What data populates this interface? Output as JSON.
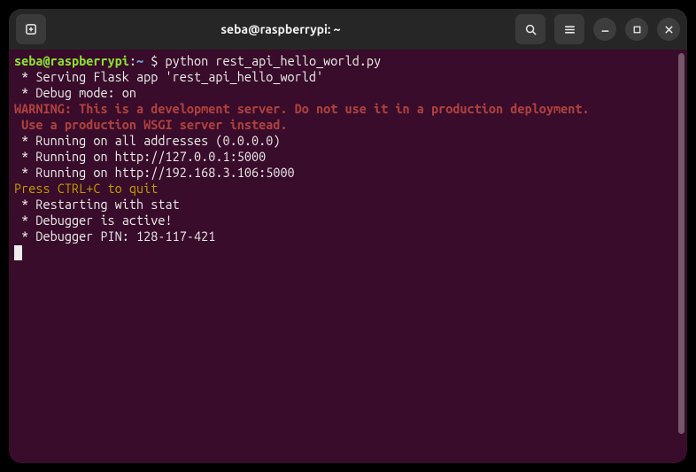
{
  "window": {
    "title": "seba@raspberrypi: ~"
  },
  "prompt": {
    "user_host": "seba@raspberrypi",
    "sep1": ":",
    "path": "~",
    "sep2": " $ ",
    "command": "python rest_api_hello_world.py"
  },
  "lines": {
    "l1": " * Serving Flask app 'rest_api_hello_world'",
    "l2": " * Debug mode: on",
    "l3": "WARNING: This is a development server. Do not use it in a production deployment.",
    "l4": " Use a production WSGI server instead.",
    "l5": " * Running on all addresses (0.0.0.0)",
    "l6": " * Running on http://127.0.0.1:5000",
    "l7": " * Running on http://192.168.3.106:5000",
    "l8": "Press CTRL+C to quit",
    "l9": " * Restarting with stat",
    "l10": " * Debugger is active!",
    "l11": " * Debugger PIN: 128-117-421"
  },
  "icons": {
    "newtab": "new-tab-icon",
    "search": "search-icon",
    "menu": "hamburger-icon",
    "minimize": "minimize-icon",
    "maximize": "maximize-icon",
    "close": "close-icon"
  }
}
